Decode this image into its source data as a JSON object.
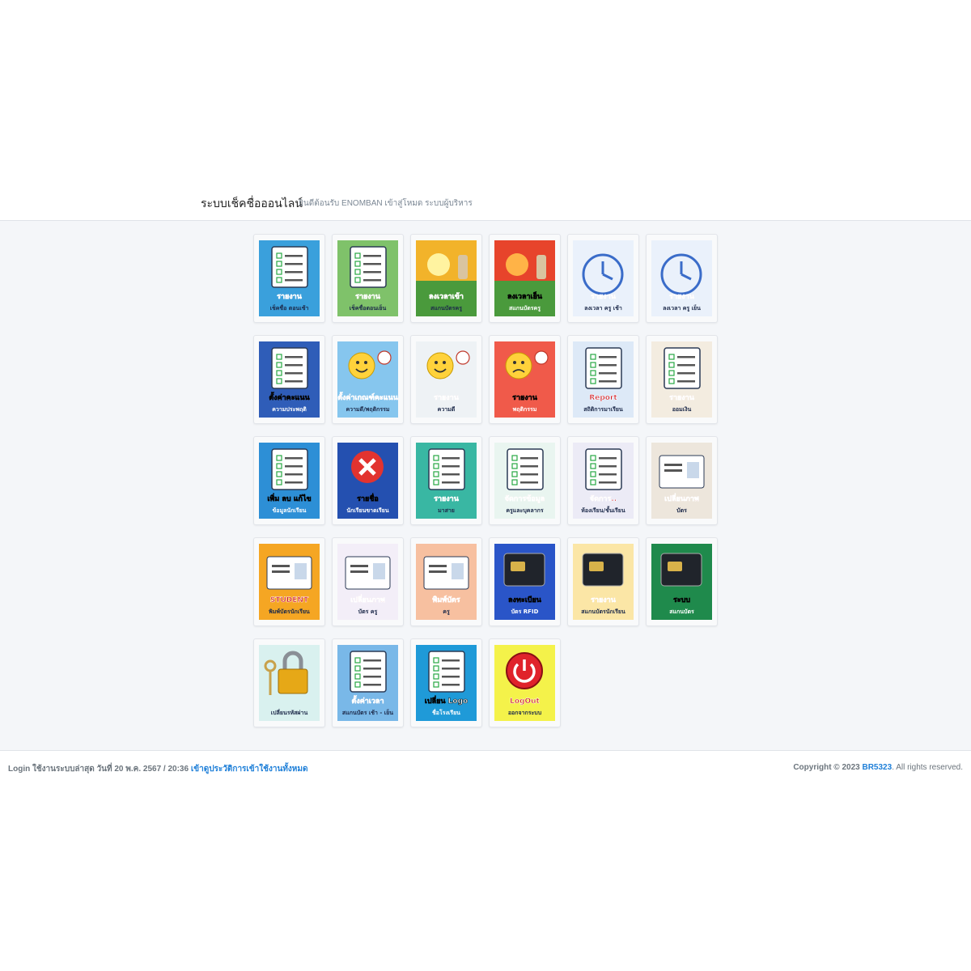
{
  "header": {
    "title": "ระบบเช็คชื่อออนไลน์",
    "subtitle": "ยินดีต้อนรับ ENOMBAN เข้าสู่โหมด ระบบผู้บริหาร"
  },
  "tiles": [
    {
      "label1": "รายงาน",
      "label2": "เช็คชื่อ ตอนเช้า",
      "icon": "clipboard-checklist-icon",
      "bg": "#3aa0dc"
    },
    {
      "label1": "รายงาน",
      "label2": "เช็คชื่อตอนเย็น",
      "icon": "clipboard-hand-icon",
      "bg": "#7fc26a"
    },
    {
      "label1": "ลงเวลาเข้า",
      "label2": "สแกนบัตรครู",
      "icon": "sunrise-scan-icon",
      "bg": "#f2b32a"
    },
    {
      "label1": "ลงเวลาเย็น",
      "label2": "สแกนบัตรครู",
      "icon": "sunset-scan-icon",
      "bg": "#e7442b"
    },
    {
      "label1": "รายงาน",
      "label2": "ลงเวลา ครู เช้า",
      "icon": "clock-report-morning-icon",
      "bg": "#eaf1fb"
    },
    {
      "label1": "รายงาน",
      "label2": "ลงเวลา ครู เย็น",
      "icon": "clock-report-evening-icon",
      "bg": "#eaf1fb"
    },
    {
      "label1": "ตั้งค่าคะแนน",
      "label2": "ความประพฤติ",
      "icon": "settings-plus-minus-icon",
      "bg": "#2f5db8"
    },
    {
      "label1": "ตั้งค่าเกณฑ์คะแนน",
      "label2": "ความดี/พฤติกรรม",
      "icon": "smiley-gear-icon",
      "bg": "#86c6ee"
    },
    {
      "label1": "รายงาน",
      "label2": "ความดี",
      "icon": "smiley-plus-icon",
      "bg": "#eef2f5"
    },
    {
      "label1": "รายงาน",
      "label2": "พฤติกรรม",
      "icon": "sad-minus-icon",
      "bg": "#f05a4a"
    },
    {
      "label1": "Report",
      "label2": "สถิติการมาเรียน",
      "icon": "report-magnifier-icon",
      "bg": "#dde9f7"
    },
    {
      "label1": "รายงาน",
      "label2": "ออมเงิน",
      "icon": "savings-report-icon",
      "bg": "#f3ece0"
    },
    {
      "label1": "เพิ่ม ลบ แก้ไข",
      "label2": "ข้อมูลนักเรียน",
      "icon": "edit-note-icon",
      "bg": "#2d8fd6"
    },
    {
      "label1": "รายชื่อ",
      "label2": "นักเรียนขาดเรียน",
      "icon": "absent-x-icon",
      "bg": "#2450b0"
    },
    {
      "label1": "รายงาน",
      "label2": "มาสาย",
      "icon": "late-runner-icon",
      "bg": "#39b7a3"
    },
    {
      "label1": "จัดการข้อมูล",
      "label2": "ครูและบุคลากร",
      "icon": "teachers-icon",
      "bg": "#e9f5f0"
    },
    {
      "label1": "จัดการ..",
      "label2": "ห้องเรียน/ชั้นเรียน",
      "icon": "classroom-icon",
      "bg": "#ecebf6"
    },
    {
      "label1": "เปลี่ยนภาพ",
      "label2": "บัตร",
      "icon": "change-card-icon",
      "bg": "#ede6dc"
    },
    {
      "label1": "STUDENT",
      "label2": "พิมพ์บัตรนักเรียน",
      "icon": "student-id-card-icon",
      "bg": "#f5a623"
    },
    {
      "label1": "เปลี่ยนภาพ",
      "label2": "บัตร ครู",
      "icon": "teacher-photo-icon",
      "bg": "#f3eef8"
    },
    {
      "label1": "พิมพ์บัตร",
      "label2": "ครู",
      "icon": "print-card-icon",
      "bg": "#f7c0a0"
    },
    {
      "label1": "ลงทะเบียน",
      "label2": "บัตร RFID",
      "icon": "rfid-register-icon",
      "bg": "#2a55c8"
    },
    {
      "label1": "รายงาน",
      "label2": "สแกนบัตรนักเรียน",
      "icon": "scan-report-icon",
      "bg": "#fbe6a6"
    },
    {
      "label1": "ระบบ",
      "label2": "สแกนบัตร",
      "icon": "card-scanner-icon",
      "bg": "#1f8a4c"
    },
    {
      "label1": "",
      "label2": "เปลี่ยนรหัสผ่าน",
      "icon": "padlock-key-icon",
      "bg": "#d9f1ef"
    },
    {
      "label1": "ตั้งค่าเวลา",
      "label2": "สแกนบัตร เช้า - เย็น",
      "icon": "time-settings-icon",
      "bg": "#79b8e8"
    },
    {
      "label1": "เปลี่ยน Logo",
      "label2": "ชื่อโรงเรียน",
      "icon": "change-logo-icon",
      "bg": "#1f9ad8"
    },
    {
      "label1": "LogOut",
      "label2": "ออกจากระบบ",
      "icon": "power-logout-icon",
      "bg": "#f4f24a"
    }
  ],
  "footer": {
    "login_text": "Login ใช้งานระบบล่าสุด วันที่ 20 พ.ค. 2567 / 20:36",
    "history_link": "เข้าดูประวัติการเข้าใช้งานทั้งหมด",
    "copyright": "Copyright © 2023",
    "brand": "BR5323",
    "rights": ". All rights reserved."
  }
}
